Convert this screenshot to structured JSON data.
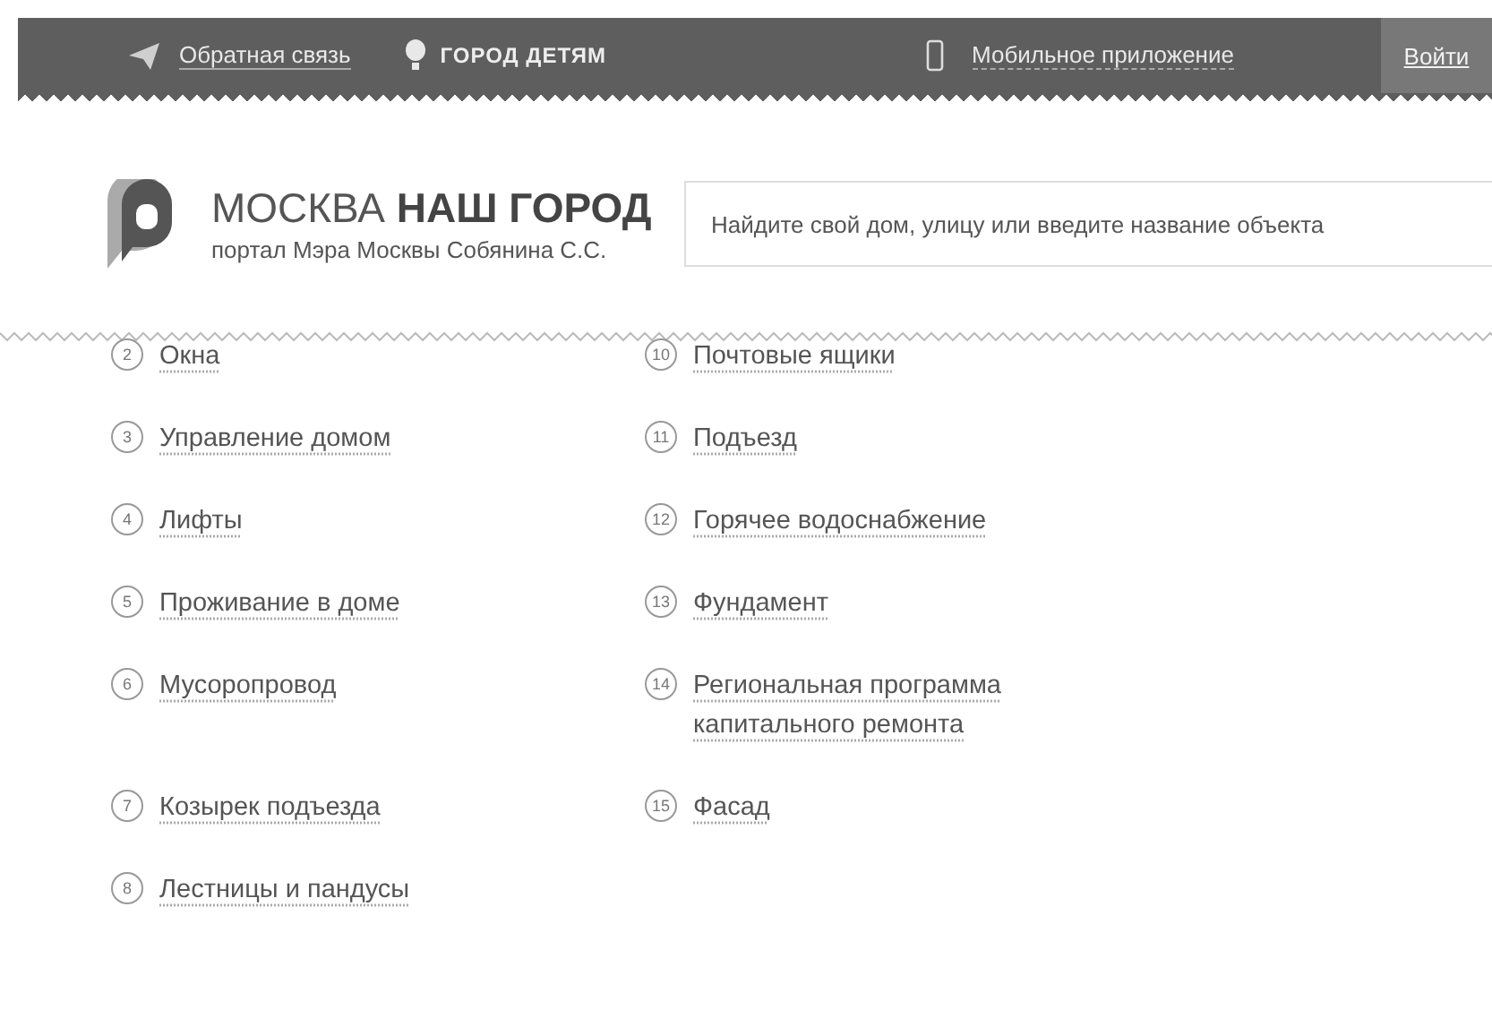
{
  "top_bar": {
    "feedback_link": "Обратная связь",
    "kids_logo": "ГОРОД ДЕТЯМ",
    "mobile_app_link": "Мобильное приложение",
    "login_button": "Войти"
  },
  "header": {
    "logo_title_light": "МОСКВА",
    "logo_title_bold": "НАШ ГОРОД",
    "logo_subtitle": "портал Мэра Москвы Собянина С.С.",
    "search": {
      "placeholder": "Найдите свой дом, улицу или введите название объекта"
    }
  },
  "topics": {
    "column_1": [
      {
        "number": "2",
        "label": "Окна"
      },
      {
        "number": "3",
        "label": "Управление домом"
      },
      {
        "number": "4",
        "label": "Лифты"
      },
      {
        "number": "5",
        "label": "Проживание в доме"
      },
      {
        "number": "6",
        "label": "Мусоропровод"
      },
      {
        "number": "7",
        "label": "Козырек подъезда"
      },
      {
        "number": "8",
        "label": "Лестницы и пандусы"
      }
    ],
    "column_2": [
      {
        "number": "10",
        "label": "Почтовые ящики"
      },
      {
        "number": "11",
        "label": "Подъезд"
      },
      {
        "number": "12",
        "label": "Горячее водоснабжение"
      },
      {
        "number": "13",
        "label": "Фундамент"
      },
      {
        "number": "14",
        "label": "Региональная программа капитального ремонта"
      },
      {
        "number": "15",
        "label": "Фасад"
      }
    ]
  }
}
